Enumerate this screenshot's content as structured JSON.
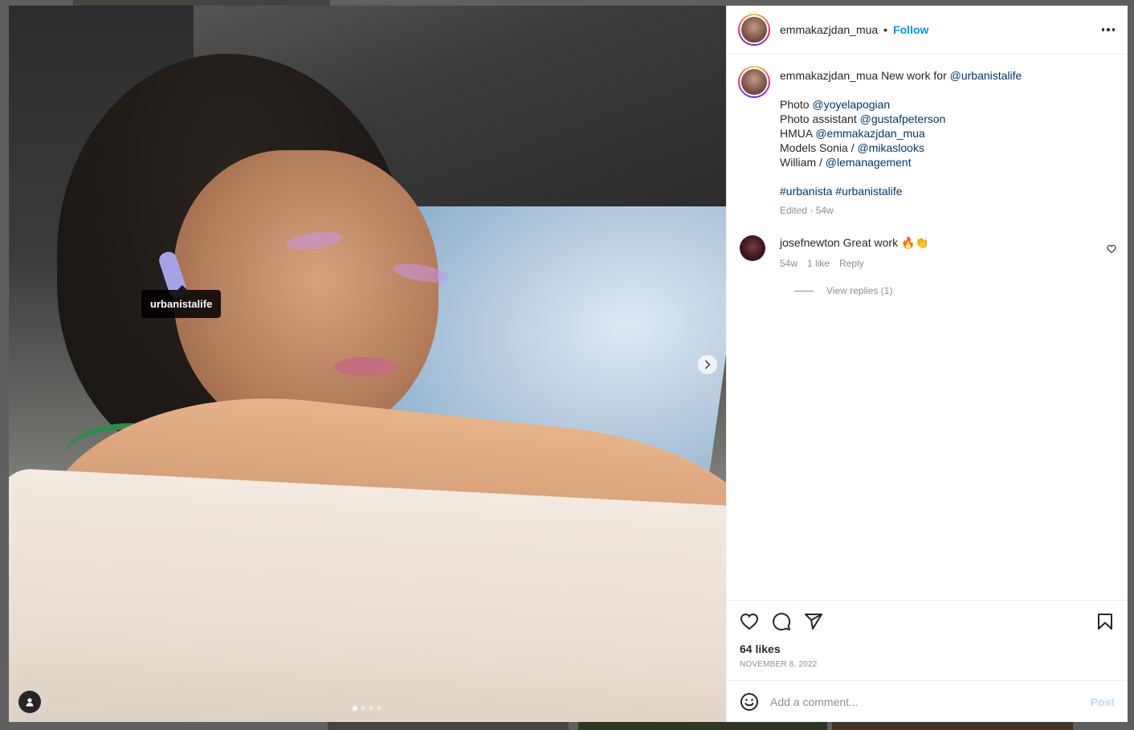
{
  "post": {
    "author": "emmakazjdan_mua",
    "follow_label": "Follow",
    "separator": "•",
    "image_tag": "urbanistalife",
    "carousel": {
      "count": 4,
      "active_index": 0
    }
  },
  "caption": {
    "username": "emmakazjdan_mua",
    "intro_text": "New work for",
    "intro_mention": "@urbanistalife",
    "credits": [
      {
        "label": "Photo",
        "mention": "@yoyelapogian"
      },
      {
        "label": "Photo assistant",
        "mention": "@gustafpeterson"
      },
      {
        "label": "HMUA",
        "mention": "@emmakazjdan_mua"
      },
      {
        "label": "Models Sonia /",
        "mention": "@mikaslooks"
      },
      {
        "label": "William /",
        "mention": "@lemanagement"
      }
    ],
    "hashtags": [
      "#urbanista",
      "#urbanistalife"
    ],
    "meta": "Edited · 54w"
  },
  "comment": {
    "username": "josefnewton",
    "text": "Great work 🔥👏",
    "age": "54w",
    "likes": "1 like",
    "reply_label": "Reply",
    "view_replies": "View replies (1)"
  },
  "stats": {
    "likes": "64 likes",
    "date": "NOVEMBER 8, 2022"
  },
  "add_comment": {
    "placeholder": "Add a comment...",
    "post_label": "Post"
  },
  "colors": {
    "link": "#00376b",
    "follow": "#0095f6",
    "post_disabled": "#b2dffc",
    "secondary_text": "#8e8e8e"
  },
  "icons": [
    "more-icon",
    "heart-icon",
    "comment-icon",
    "share-icon",
    "bookmark-icon",
    "emoji-icon",
    "chevron-right-icon",
    "user-tags-icon"
  ]
}
